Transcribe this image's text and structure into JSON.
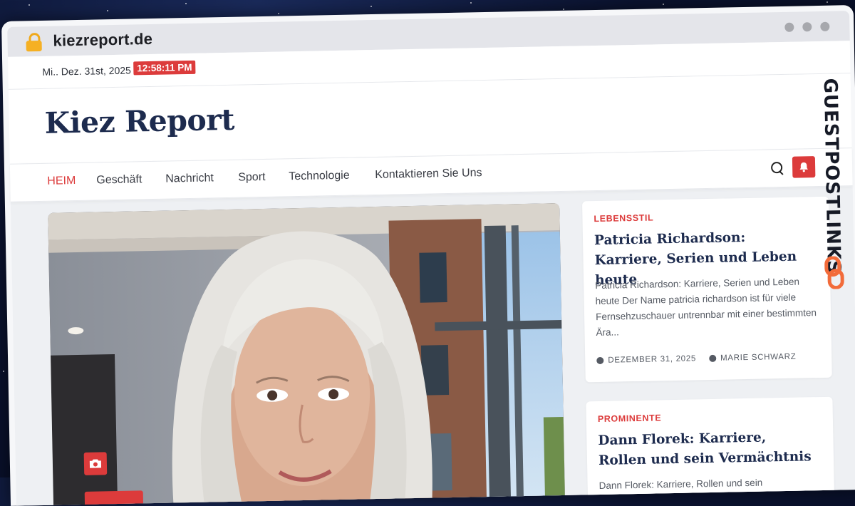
{
  "browser": {
    "url": "kiezreport.de"
  },
  "topbar": {
    "date": "Mi.. Dez. 31st, 2025",
    "time": "12:58:11 PM"
  },
  "site": {
    "title": "Kiez Report"
  },
  "nav": {
    "items": [
      {
        "label": "HEIM",
        "active": true
      },
      {
        "label": "Geschäft"
      },
      {
        "label": "Nachricht"
      },
      {
        "label": "Sport"
      },
      {
        "label": "Technologie"
      },
      {
        "label": "Kontaktieren Sie Uns"
      }
    ]
  },
  "articles": [
    {
      "category": "LEBENSSTIL",
      "title": "Patricia Richardson: Karriere, Serien und Leben heute",
      "excerpt": "Patricia Richardson: Karriere, Serien und Leben heute Der Name patricia richardson ist für viele Fernsehzuschauer untrennbar mit einer bestimmten Ära...",
      "date": "DEZEMBER 31, 2025",
      "author": "MARIE SCHWARZ"
    },
    {
      "category": "PROMINENTE",
      "title": "Dann Florek: Karriere, Rollen und sein Vermächtnis",
      "excerpt": "Dann Florek: Karriere, Rollen und sein"
    }
  ],
  "watermark": {
    "text": "GUESTPOSTLINKS"
  },
  "colors": {
    "accent": "#dc3b3b",
    "navy": "#1d2b4e",
    "watermark_orange": "#f26b3a"
  }
}
